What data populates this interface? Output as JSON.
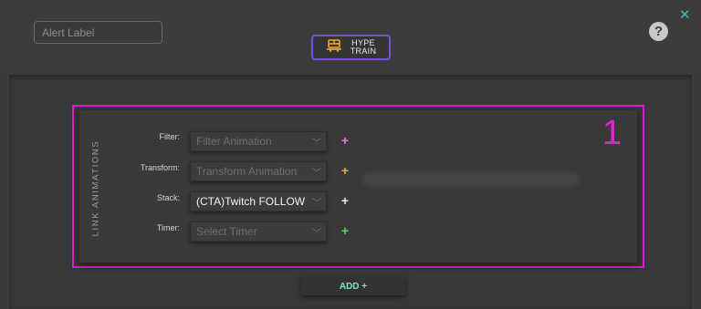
{
  "header": {
    "alert_label_placeholder": "Alert Label",
    "hype_button": {
      "line1": "HYPE",
      "line2": "TRAIN",
      "icon": "train-icon",
      "accent": "#7b4fd6"
    },
    "help_icon": "?",
    "close_icon": "✕"
  },
  "panel": {
    "side_title": "LINK ANIMATIONS",
    "number": "1",
    "rows": [
      {
        "label": "Filter:",
        "value": "Filter Animation",
        "active": false,
        "plus_color": "#e07de0"
      },
      {
        "label": "Transform:",
        "value": "Transform Animation",
        "active": false,
        "plus_color": "#e0b060"
      },
      {
        "label": "Stack:",
        "value": "(CTA)Twitch FOLLOW",
        "active": true,
        "plus_color": "#f0f0f0"
      },
      {
        "label": "Timer:",
        "value": "Select Timer",
        "active": false,
        "plus_color": "#55d26a"
      }
    ],
    "plus_symbol": "+",
    "highlight_color": "#d51fd0"
  },
  "footer": {
    "add_label": "ADD +"
  }
}
